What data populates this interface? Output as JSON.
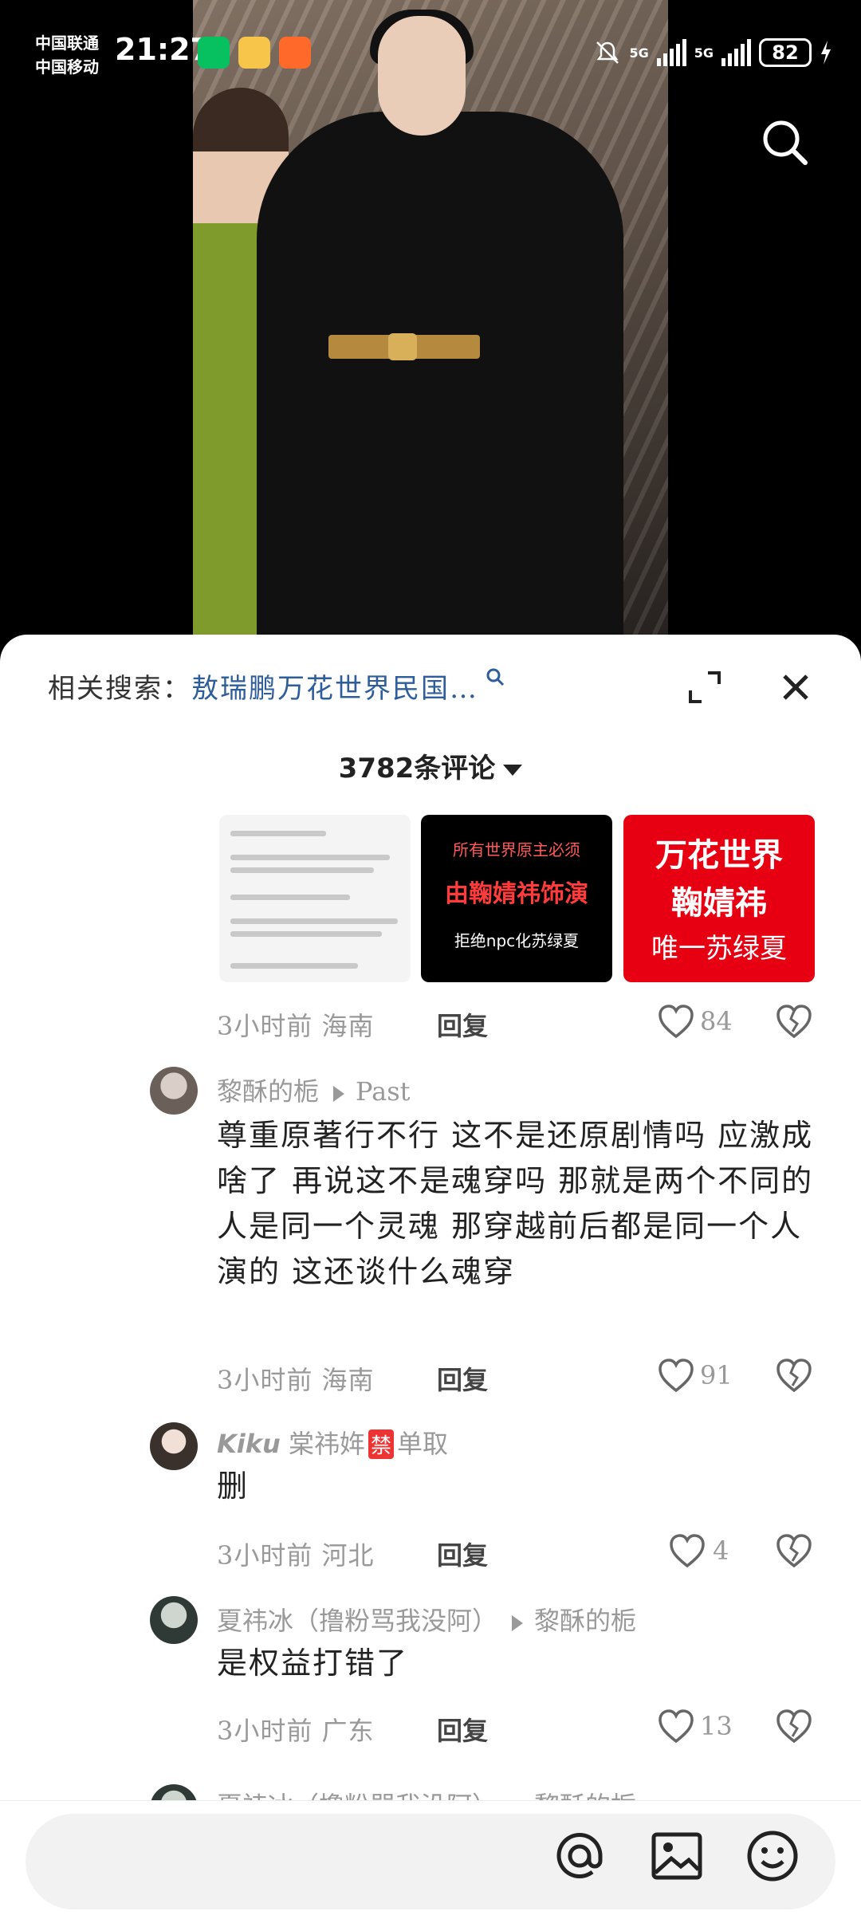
{
  "status_bar": {
    "carrier_1": "中国联通",
    "carrier_2": "中国移动",
    "time": "21:27",
    "network_1": "5G",
    "network_2": "5G",
    "battery": "82",
    "notification_apps": [
      "wechat-icon",
      "weibo-icon",
      "kuaishou-icon"
    ]
  },
  "sheet": {
    "related_label": "相关搜索：",
    "related_query": "敖瑞鹏万花世界民国…",
    "comment_count": "3782条评论"
  },
  "images": {
    "thumb2": {
      "line1": "所有世界原主必须",
      "line2": "由鞠婧祎饰演",
      "line3": "拒绝npc化苏绿夏"
    },
    "thumb3": {
      "line1": "万花世界",
      "line2": "鞠婧祎",
      "line3": "唯一苏绿夏"
    }
  },
  "comments": [
    {
      "time": "3小时前 海南",
      "reply_label": "回复",
      "likes": "84"
    },
    {
      "user": "黎酥的栀",
      "reply_to": "Past",
      "text": "尊重原著行不行 这不是还原剧情吗 应激成啥了 再说这不是魂穿吗 那就是两个不同的人是同一个灵魂 那穿越前后都是同一个人演的 这还谈什么魂穿",
      "time": "3小时前 海南",
      "reply_label": "回复",
      "likes": "91"
    },
    {
      "user_prefix": "Kiku",
      "user_mid": "棠祎姩",
      "user_badge": "禁",
      "user_suffix": "单取",
      "text": "删",
      "time": "3小时前 河北",
      "reply_label": "回复",
      "likes": "4"
    },
    {
      "user": "夏祎冰（撸粉骂我没阿）",
      "reply_to": "黎酥的栀",
      "text": "是权益打错了",
      "time": "3小时前 广东",
      "reply_label": "回复",
      "likes": "13"
    },
    {
      "user": "夏祎冰（撸粉骂我没阿）",
      "reply_to": "黎酥的栀"
    }
  ],
  "colors": {
    "link": "#2d5d9b",
    "thumb3_bg": "#e60012",
    "badge": "#e33333"
  }
}
